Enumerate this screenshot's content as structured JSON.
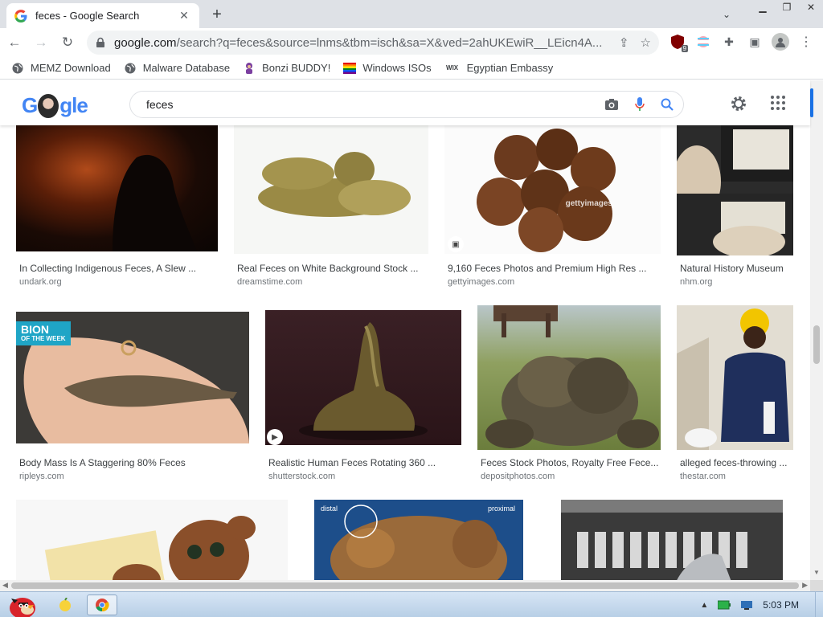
{
  "browser": {
    "tab_title": "feces - Google Search",
    "url_host": "google.com",
    "url_path": "/search?q=feces&source=lnms&tbm=isch&sa=X&ved=2ahUKEwiR__LEicn4A...",
    "extension_badge": "9"
  },
  "bookmarks": [
    {
      "label": "MEMZ Download"
    },
    {
      "label": "Malware Database"
    },
    {
      "label": "Bonzi BUDDY!"
    },
    {
      "label": "Windows ISOs"
    },
    {
      "label": "Egyptian Embassy"
    }
  ],
  "bookmark_icon_text": "WIX",
  "google": {
    "logo_prefix": "G",
    "logo_suffix": "gle",
    "query": "feces"
  },
  "results": [
    {
      "title": "In Collecting Indigenous Feces, A Slew ...",
      "source": "undark.org"
    },
    {
      "title": "Real Feces on White Background Stock ...",
      "source": "dreamstime.com"
    },
    {
      "title": "9,160 Feces Photos and Premium High Res ...",
      "source": "gettyimages.com"
    },
    {
      "title": "Natural History Museum",
      "source": "nhm.org"
    },
    {
      "title": "Body Mass Is A Staggering 80% Feces",
      "source": "ripleys.com"
    },
    {
      "title": "Realistic Human Feces Rotating 360 ...",
      "source": "shutterstock.com"
    },
    {
      "title": "Feces Stock Photos, Royalty Free Fece...",
      "source": "depositphotos.com"
    },
    {
      "title": "alleged feces-throwing ...",
      "source": "thestar.com"
    }
  ],
  "overlays": {
    "bion_line1": "BION",
    "bion_line2": "OF THE WEEK",
    "getty": "gettyimages",
    "distal": "distal",
    "proximal": "proximal"
  },
  "taskbar": {
    "clock": "5:03 PM"
  },
  "colors": {
    "accent_blue": "#1a73e8",
    "tab_strip": "#dee1e6",
    "omnibox": "#f1f3f4"
  }
}
